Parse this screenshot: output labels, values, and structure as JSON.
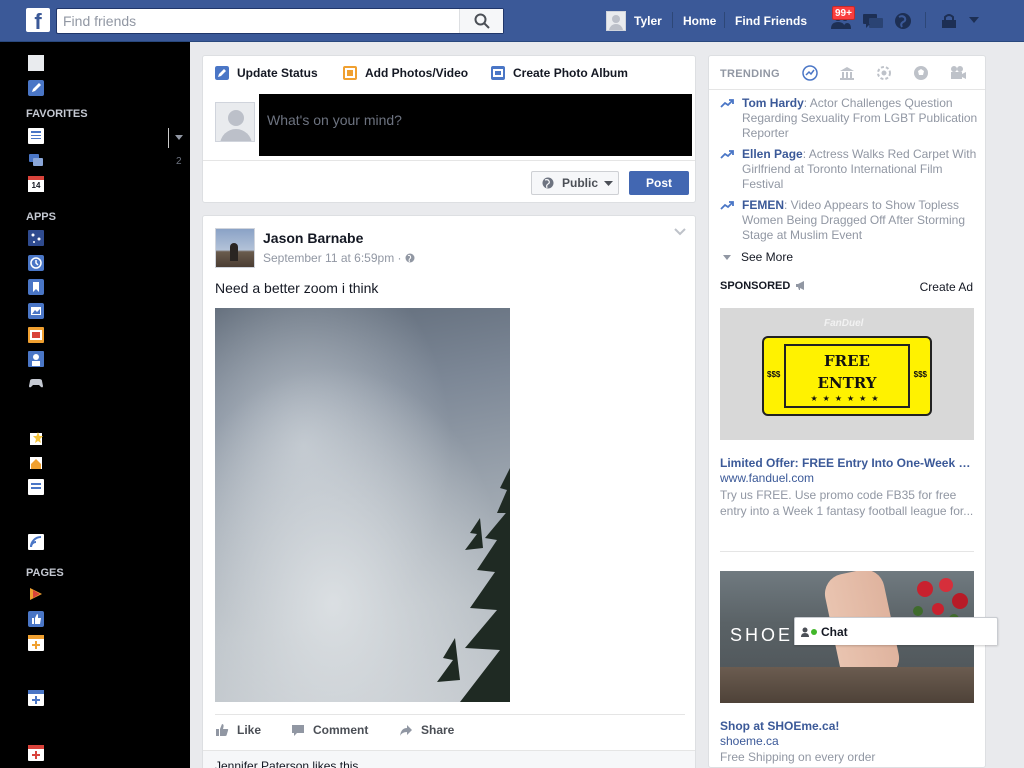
{
  "topbar": {
    "logo": "f",
    "search_placeholder": "Find friends",
    "user_name": "Tyler",
    "home_label": "Home",
    "find_friends_label": "Find Friends",
    "friend_requests_count": "99+"
  },
  "sidebar": {
    "favorites_label": "FAVORITES",
    "apps_label": "APPS",
    "pages_label": "PAGES",
    "messages_count": "2",
    "calendar_day": "14"
  },
  "composer": {
    "tabs": [
      {
        "label": "Update Status"
      },
      {
        "label": "Add Photos/Video"
      },
      {
        "label": "Create Photo Album"
      }
    ],
    "input_placeholder": "What's on your mind?",
    "privacy_label": "Public",
    "post_label": "Post"
  },
  "story": {
    "author": "Jason Barnabe",
    "timestamp": "September 11 at 6:59pm",
    "separator": "·",
    "text": "Need a better zoom i think",
    "actions": {
      "like": "Like",
      "comment": "Comment",
      "share": "Share"
    },
    "likes_text": "Jennifer Paterson likes this."
  },
  "trending": {
    "title": "TRENDING",
    "items": [
      {
        "name": "Tom Hardy",
        "description": ": Actor Challenges Question Regarding Sexuality From LGBT Publication Reporter"
      },
      {
        "name": "Ellen Page",
        "description": ": Actress Walks Red Carpet With Girlfriend at Toronto International Film Festival"
      },
      {
        "name": "FEMEN",
        "description": ": Video Appears to Show Topless Women Being Dragged Off After Storming Stage at Muslim Event"
      }
    ],
    "see_more": "See More"
  },
  "sponsored": {
    "title": "SPONSORED",
    "create_ad": "Create Ad",
    "ads": [
      {
        "brand_watermark": "FanDuel",
        "ticket_line1": "FREE",
        "ticket_line2": "ENTRY",
        "ticket_side": "$$$",
        "ticket_stars": "★★★★★★",
        "title": "Limited Offer: FREE Entry Into One-Week Fantasy Football",
        "url": "www.fanduel.com",
        "description": "Try us FREE. Use promo code FB35 for free entry into a Week 1 fantasy football league for..."
      },
      {
        "image_text": "SHOEM",
        "title": "Shop at SHOEme.ca!",
        "url": "shoeme.ca",
        "description": "Free Shipping on every order"
      }
    ]
  },
  "chat": {
    "label": "Chat"
  },
  "colors": {
    "brand_blue": "#3b5998",
    "link_blue": "#3b5998",
    "post_button": "#4267b2",
    "badge_red": "#fa3e3e",
    "ticket_yellow": "#fff200"
  }
}
